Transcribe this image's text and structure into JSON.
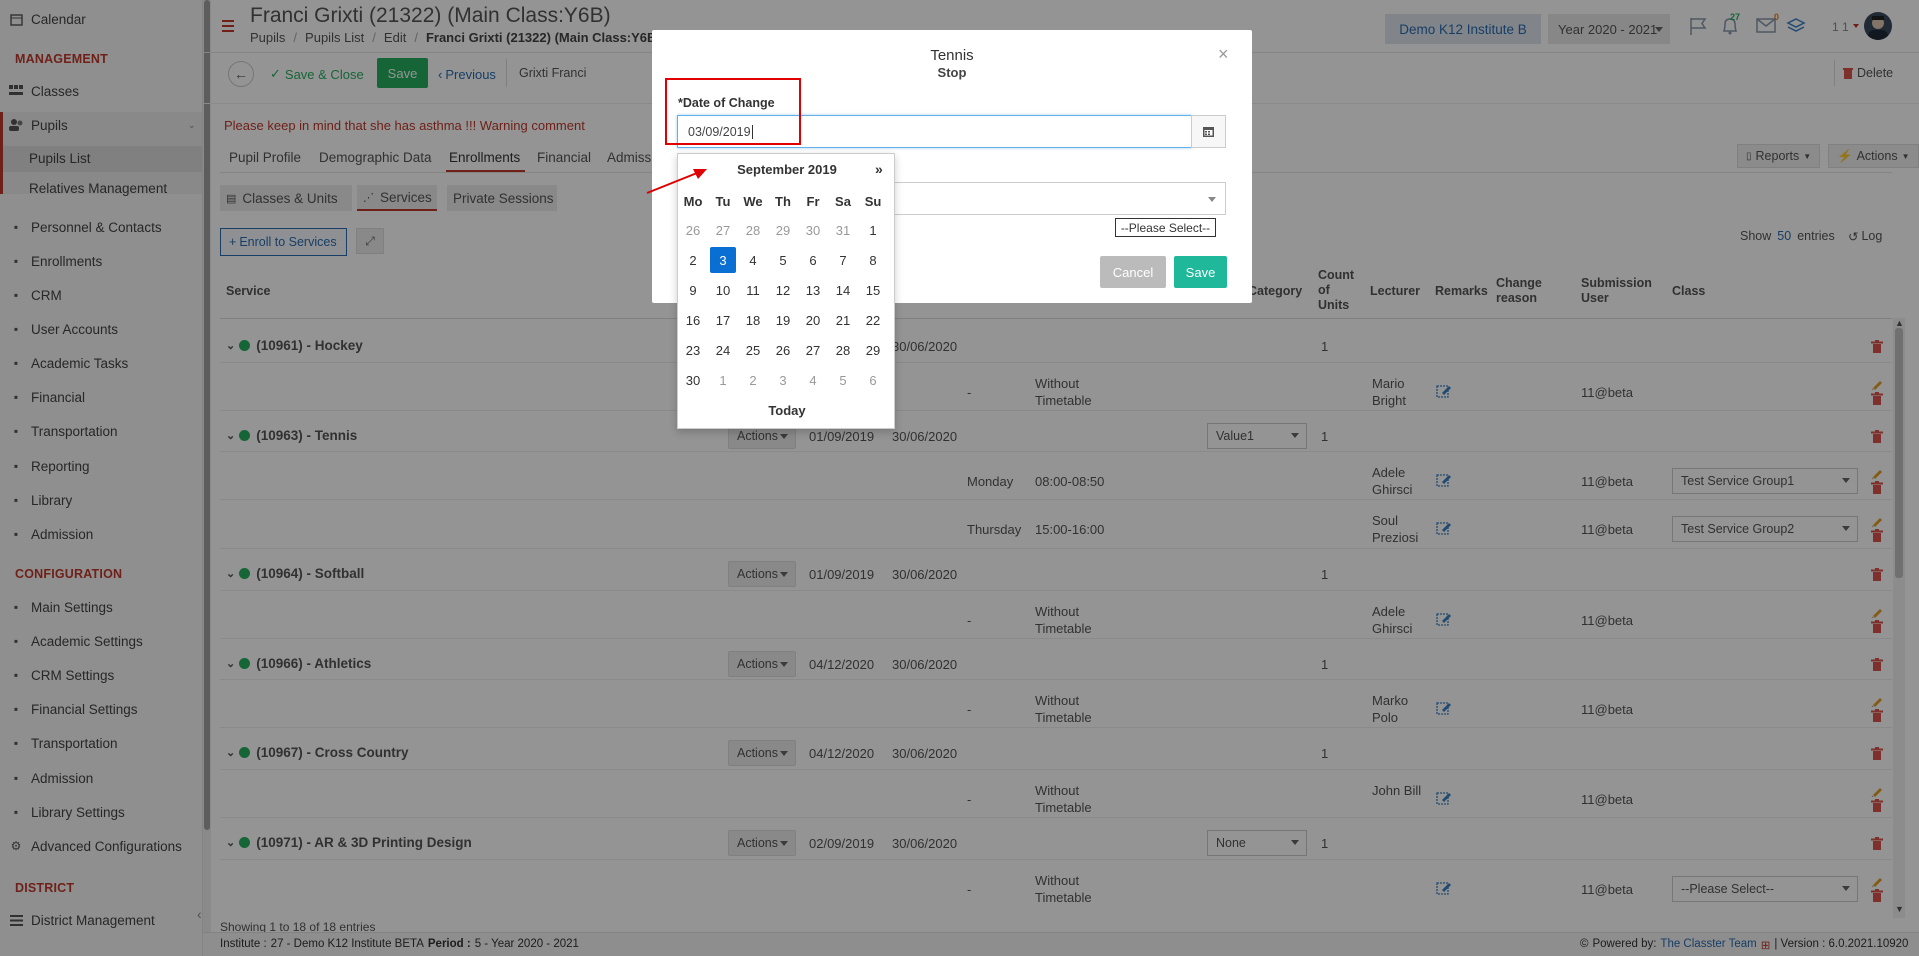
{
  "sidebar": {
    "top_item": {
      "label": "Calendar",
      "icon": "calendar-icon"
    },
    "management_header": "MANAGEMENT",
    "classes": "Classes",
    "pupils": "Pupils",
    "pupils_list": "Pupils List",
    "relatives": "Relatives Management",
    "items": [
      {
        "label": "Personnel & Contacts",
        "icon": "user-icon"
      },
      {
        "label": "Enrollments",
        "icon": "exchange-icon"
      },
      {
        "label": "CRM",
        "icon": "chart-icon"
      },
      {
        "label": "User Accounts",
        "icon": "key-icon"
      },
      {
        "label": "Academic Tasks",
        "icon": "grid-icon"
      },
      {
        "label": "Financial",
        "icon": "money-icon"
      },
      {
        "label": "Transportation",
        "icon": "bus-icon"
      },
      {
        "label": "Reporting",
        "icon": "print-icon"
      },
      {
        "label": "Library",
        "icon": "book-icon"
      },
      {
        "label": "Admission",
        "icon": "bank-icon"
      }
    ],
    "configuration_header": "CONFIGURATION",
    "config_items": [
      {
        "label": "Main Settings",
        "icon": "list-icon"
      },
      {
        "label": "Academic Settings",
        "icon": "sitemap-icon"
      },
      {
        "label": "CRM Settings",
        "icon": "chart-icon"
      },
      {
        "label": "Financial Settings",
        "icon": "money-icon"
      },
      {
        "label": "Transportation",
        "icon": "bus-icon"
      },
      {
        "label": "Admission",
        "icon": "bank-icon"
      },
      {
        "label": "Library Settings",
        "icon": "book-icon"
      },
      {
        "label": "Advanced Configurations",
        "icon": "gear-icon"
      }
    ],
    "district_header": "DISTRICT",
    "district_item": {
      "label": "District Management",
      "icon": "menu-icon"
    },
    "collapse_arrow": "‹"
  },
  "header": {
    "title": "Franci Grixti (21322) (Main Class:Y6B)",
    "breadcrumb": [
      "Pupils",
      "Pupils List",
      "Edit",
      "Franci Grixti (21322) (Main Class:Y6B)"
    ],
    "breadcrumb_sep": "/",
    "institute": "Demo K12 Institute B",
    "year": "Year 2020 - 2021",
    "badge_green": "27",
    "badge_orange": "0",
    "user": "1 1"
  },
  "toolbar": {
    "save_close": "Save & Close",
    "save": "Save",
    "previous": "Previous",
    "search_value": "Grixti Franci",
    "delete": "Delete"
  },
  "warning": "Please keep in mind that she has asthma !!! Warning comment",
  "tabs": [
    "Pupil Profile",
    "Demographic Data",
    "Enrollments",
    "Financial",
    "Admiss"
  ],
  "reports": "Reports",
  "actions": "Actions",
  "subtabs": [
    "Classes & Units",
    "Services",
    "Private Sessions"
  ],
  "enroll_button": "Enroll to Services",
  "show_label": "Show",
  "show_count": "50",
  "entries_label": "entries",
  "log_label": "Log",
  "columns": {
    "service": "Service",
    "category": "Category",
    "count": "Count of Units",
    "lecturer": "Lecturer",
    "remarks": "Remarks",
    "change": "Change reason",
    "submission": "Submission User",
    "class": "Class"
  },
  "services": [
    {
      "name": "(10961) - Hockey",
      "start": "",
      "end": "30/06/2020",
      "count": "1",
      "category": "",
      "subs": [
        {
          "day": "",
          "time": "",
          "without": "Without Timetable",
          "lecturer": "Mario Bright",
          "user": "11@beta",
          "cls": ""
        }
      ]
    },
    {
      "name": "(10963) - Tennis",
      "start": "01/09/2019",
      "end": "30/06/2020",
      "count": "1",
      "category": "Value1",
      "subs": [
        {
          "day": "Monday",
          "time": "08:00-08:50",
          "lecturer": "Adele Ghirsci",
          "user": "11@beta",
          "cls": "Test Service Group1"
        },
        {
          "day": "Thursday",
          "time": "15:00-16:00",
          "lecturer": "Soul Preziosi",
          "user": "11@beta",
          "cls": "Test Service Group2"
        }
      ]
    },
    {
      "name": "(10964) - Softball",
      "start": "01/09/2019",
      "end": "30/06/2020",
      "count": "1",
      "category": "",
      "subs": [
        {
          "dash": "-",
          "without": "Without Timetable",
          "lecturer": "Adele Ghirsci",
          "user": "11@beta"
        }
      ]
    },
    {
      "name": "(10966) - Athletics",
      "start": "04/12/2020",
      "end": "30/06/2020",
      "count": "1",
      "category": "",
      "subs": [
        {
          "dash": "-",
          "without": "Without Timetable",
          "lecturer": "Marko Polo",
          "user": "11@beta"
        }
      ]
    },
    {
      "name": "(10967) - Cross Country",
      "start": "04/12/2020",
      "end": "30/06/2020",
      "count": "1",
      "category": "",
      "subs": [
        {
          "dash": "-",
          "without": "Without Timetable",
          "lecturer": "John Bill",
          "user": "11@beta"
        }
      ]
    },
    {
      "name": "(10971) - AR & 3D Printing Design",
      "start": "02/09/2019",
      "end": "30/06/2020",
      "count": "1",
      "category": "None",
      "subs": [
        {
          "dash": "-",
          "without": "Without Timetable",
          "lecturer": "",
          "user": "11@beta",
          "cls": "--Please Select--"
        }
      ]
    }
  ],
  "row_actions": "Actions",
  "first_dash": "-",
  "showing": "Showing 1 to 18 of 18 entries",
  "footer": {
    "institute_label": "Institute :",
    "institute": "27 - Demo K12 Institute BETA",
    "period_label": "Period :",
    "period": "5 - Year 2020 - 2021",
    "powered": "Powered by:",
    "team": "The Classter Team",
    "version": "| Version : 6.0.2021.10920"
  },
  "modal": {
    "title": "Tennis",
    "subtitle": "Stop",
    "date_label": "*Date of Change",
    "date_value": "03/09/2019",
    "please_select": "--Please Select--",
    "cancel": "Cancel",
    "save": "Save",
    "close": "×"
  },
  "calendar": {
    "month": "September 2019",
    "next": "»",
    "dow": [
      "Mo",
      "Tu",
      "We",
      "Th",
      "Fr",
      "Sa",
      "Su"
    ],
    "weeks": [
      [
        "26",
        "27",
        "28",
        "29",
        "30",
        "31",
        "1"
      ],
      [
        "2",
        "3",
        "4",
        "5",
        "6",
        "7",
        "8"
      ],
      [
        "9",
        "10",
        "11",
        "12",
        "13",
        "14",
        "15"
      ],
      [
        "16",
        "17",
        "18",
        "19",
        "20",
        "21",
        "22"
      ],
      [
        "23",
        "24",
        "25",
        "26",
        "27",
        "28",
        "29"
      ],
      [
        "30",
        "1",
        "2",
        "3",
        "4",
        "5",
        "6"
      ]
    ],
    "selected": "3",
    "today": "Today"
  },
  "colors": {
    "accent_green": "#27ae60",
    "warning_red": "#c0392b",
    "selected_blue": "#0a6fd3",
    "annotation_red": "#e00000"
  }
}
